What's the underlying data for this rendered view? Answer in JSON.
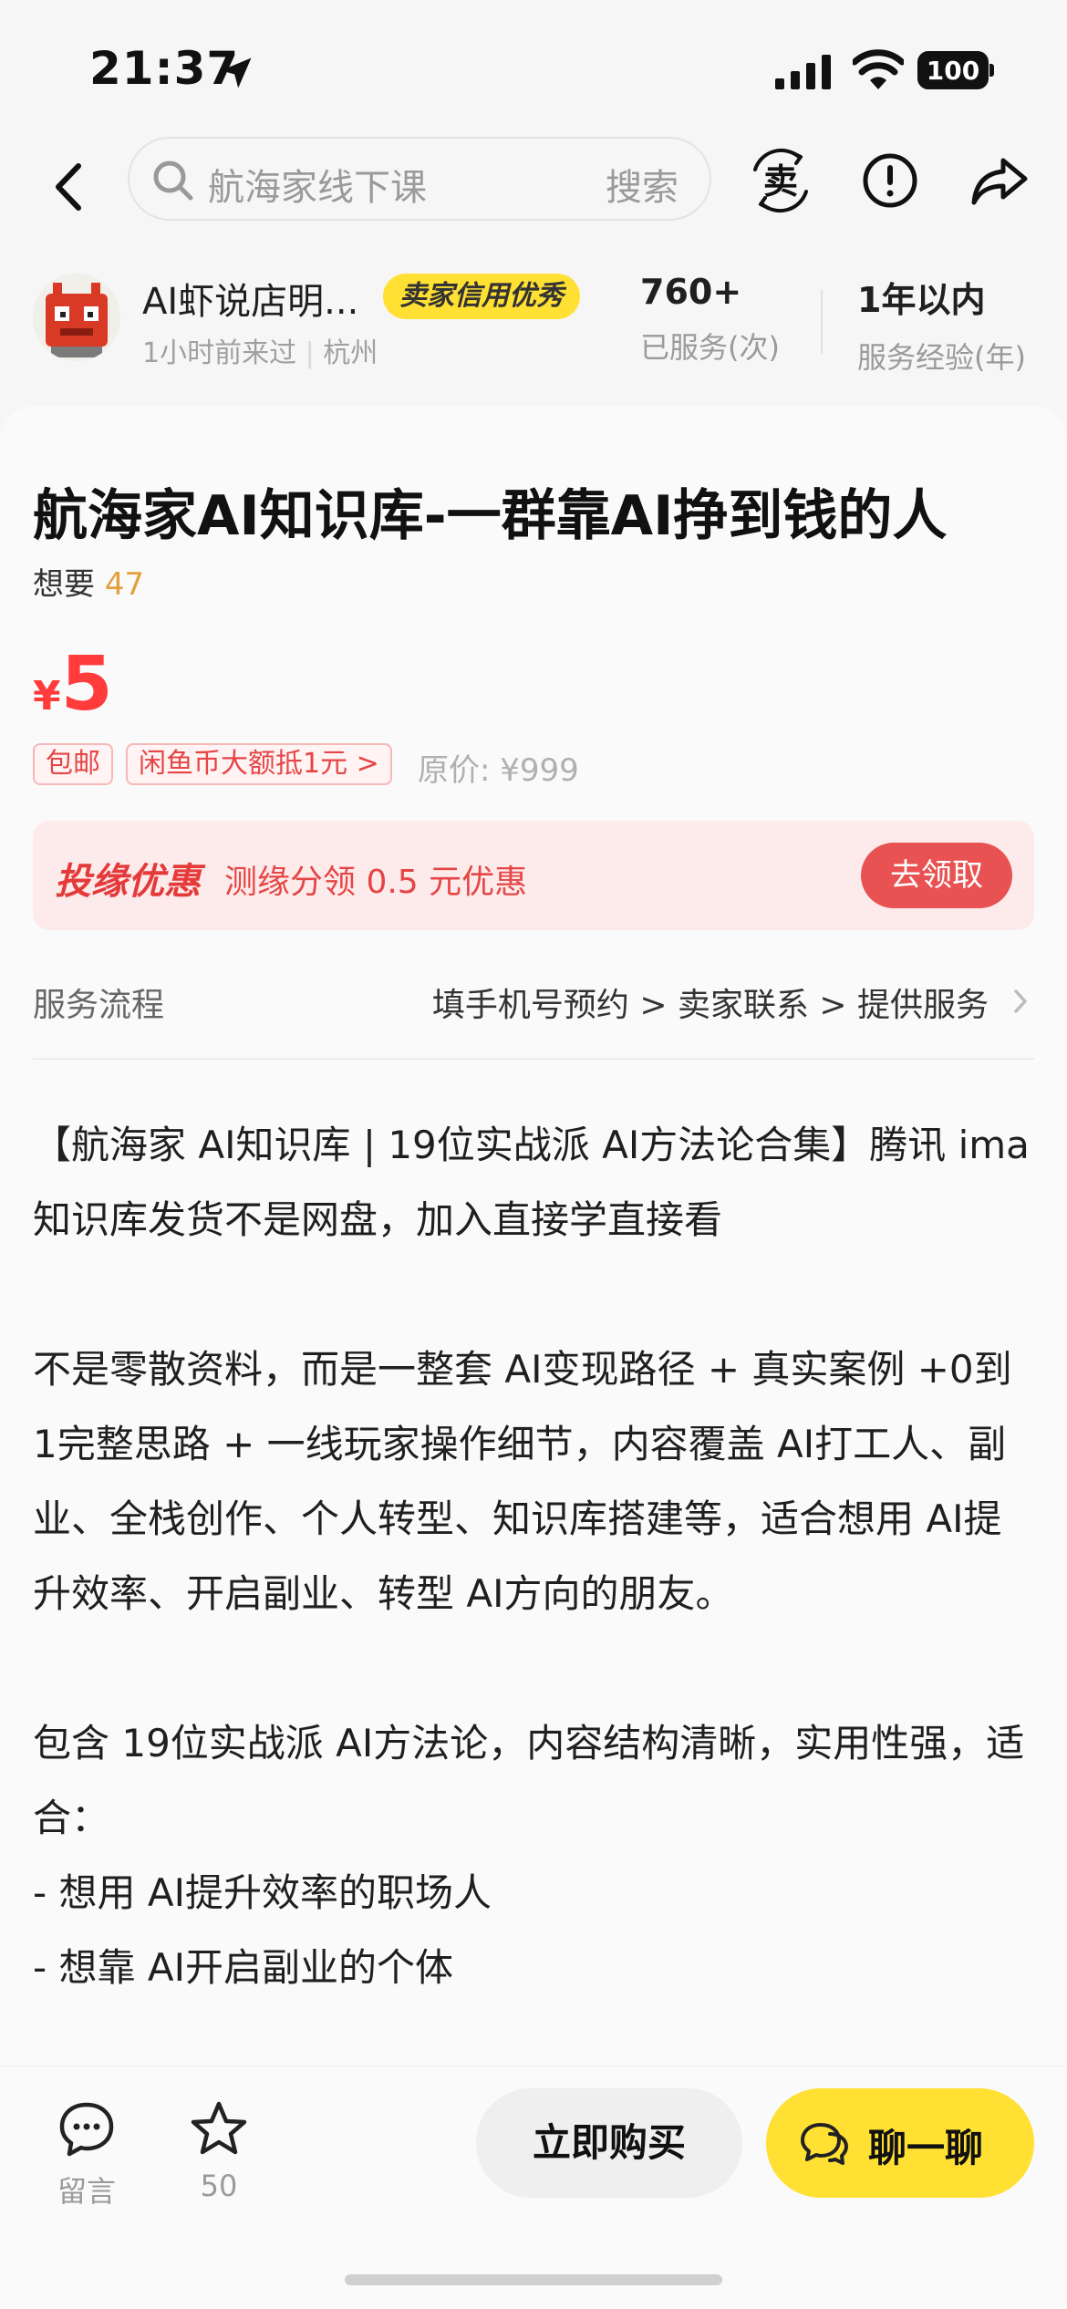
{
  "status_bar": {
    "time": "21:37",
    "battery": "100"
  },
  "nav": {
    "search_placeholder": "航海家线下课",
    "search_button": "搜索",
    "icons": [
      "back-icon",
      "seller-icon",
      "report-icon",
      "share-icon"
    ]
  },
  "seller": {
    "name": "AI虾说店明...",
    "badge": "卖家信用优秀",
    "last_seen": "1小时前来过",
    "city": "杭州",
    "stats": [
      {
        "value": "760+",
        "label": "已服务(次)"
      },
      {
        "value": "1年以内",
        "label": "服务经验(年)"
      }
    ]
  },
  "product": {
    "title": "航海家AI知识库-一群靠AI挣到钱的人",
    "want_label": "想要",
    "want_count": "47",
    "price_symbol": "¥",
    "price": "5",
    "tags": [
      "包邮",
      "闲鱼币大额抵1元 >"
    ],
    "original_price": "原价: ¥999",
    "promo": {
      "brand": "投缘优惠",
      "text": "测缘分领 0.5 元优惠",
      "button": "去领取"
    },
    "service": {
      "label": "服务流程",
      "steps": "填手机号预约 > 卖家联系 > 提供服务"
    },
    "description": [
      "【航海家 AI知识库 | 19位实战派 AI方法论合集】腾讯 ima知识库发货不是网盘，加入直接学直接看",
      "",
      "不是零散资料，而是一整套 AI变现路径 + 真实案例 +0到1完整思路 + 一线玩家操作细节，内容覆盖 AI打工人、副业、全栈创作、个人转型、知识库搭建等，适合想用 AI提升效率、开启副业、转型 AI方向的朋友。",
      "",
      "包含 19位实战派 AI方法论，内容结构清晰，实用性强，适合：",
      "- 想用 AI提升效率的职场人",
      "- 想靠 AI开启副业的个体"
    ]
  },
  "bottom_bar": {
    "comment_label": "留言",
    "favorite_count": "50",
    "buy_label": "立即购买",
    "chat_label": "聊一聊"
  },
  "colors": {
    "price_red": "#ff3b3b",
    "badge_yellow": "#ffe033",
    "promo_bg": "#fdebeb",
    "want_orange": "#e3a03b"
  }
}
